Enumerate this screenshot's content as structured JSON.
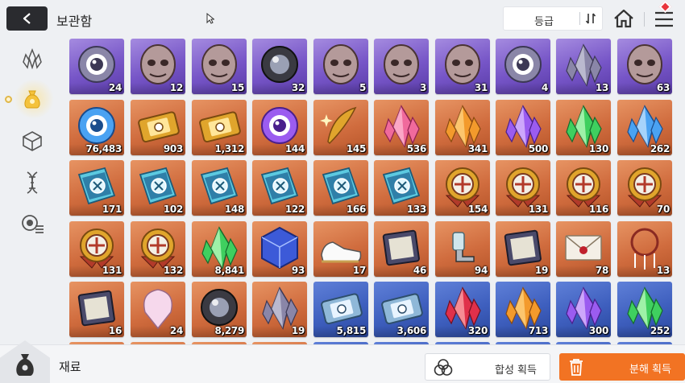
{
  "header": {
    "title": "보관함",
    "sort_label": "등급"
  },
  "sidebar": {
    "tabs": [
      {
        "icon": "crystal-cluster-icon",
        "active": false
      },
      {
        "icon": "material-bag-icon",
        "active": true
      },
      {
        "icon": "cube-icon",
        "active": false
      },
      {
        "icon": "dna-icon",
        "active": false
      },
      {
        "icon": "orb-list-icon",
        "active": false
      }
    ]
  },
  "inventory": {
    "rows": [
      [
        {
          "bg": "purple",
          "icon": "eye-card-icon",
          "qty": "24"
        },
        {
          "bg": "purple",
          "icon": "brain-head-icon",
          "qty": "12"
        },
        {
          "bg": "purple",
          "icon": "flesh-lump-icon",
          "qty": "15"
        },
        {
          "bg": "purple",
          "icon": "silver-orb-icon",
          "qty": "32"
        },
        {
          "bg": "purple",
          "icon": "monster-skull-icon",
          "qty": "5"
        },
        {
          "bg": "purple",
          "icon": "fleshy-head-icon",
          "qty": "3"
        },
        {
          "bg": "purple",
          "icon": "bloody-mass-icon",
          "qty": "31"
        },
        {
          "bg": "purple",
          "icon": "eyeball-icon",
          "qty": "4"
        },
        {
          "bg": "purple",
          "icon": "crystal-head-icon",
          "qty": "13"
        },
        {
          "bg": "purple",
          "icon": "shell-mask-icon",
          "qty": "63"
        }
      ],
      [
        {
          "bg": "orange",
          "icon": "blue-eye-core-icon",
          "qty": "76,483"
        },
        {
          "bg": "orange",
          "icon": "gold-ticket-icon",
          "qty": "903"
        },
        {
          "bg": "orange",
          "icon": "gold-prism-ticket-icon",
          "qty": "1,312"
        },
        {
          "bg": "orange",
          "icon": "purple-eye-core-icon",
          "qty": "144"
        },
        {
          "bg": "orange",
          "icon": "golden-feather-icon",
          "qty": "145"
        },
        {
          "bg": "orange",
          "icon": "pink-crystal-icon",
          "qty": "536"
        },
        {
          "bg": "orange",
          "icon": "orange-crystal-icon",
          "qty": "341"
        },
        {
          "bg": "orange",
          "icon": "purple-crystal-icon",
          "qty": "500"
        },
        {
          "bg": "orange",
          "icon": "green-crystal-icon",
          "qty": "130"
        },
        {
          "bg": "orange",
          "icon": "blue-crystal-icon",
          "qty": "262"
        }
      ],
      [
        {
          "bg": "orange",
          "icon": "spellbook-swords-icon",
          "qty": "171"
        },
        {
          "bg": "orange",
          "icon": "spellbook-shield-icon",
          "qty": "102"
        },
        {
          "bg": "orange",
          "icon": "spellbook-eye-icon",
          "qty": "148"
        },
        {
          "bg": "orange",
          "icon": "spellbook-cross-icon",
          "qty": "122"
        },
        {
          "bg": "orange",
          "icon": "spellbook-rune-icon",
          "qty": "166"
        },
        {
          "bg": "orange",
          "icon": "spellbook-orb-icon",
          "qty": "133"
        },
        {
          "bg": "orange",
          "icon": "medal-sword-icon",
          "qty": "154"
        },
        {
          "bg": "orange",
          "icon": "medal-shield-icon",
          "qty": "131"
        },
        {
          "bg": "orange",
          "icon": "medal-target-icon",
          "qty": "116"
        },
        {
          "bg": "orange",
          "icon": "medal-star-icon",
          "qty": "70"
        }
      ],
      [
        {
          "bg": "orange",
          "icon": "medal-compass-icon",
          "qty": "131"
        },
        {
          "bg": "orange",
          "icon": "medal-globe-icon",
          "qty": "132"
        },
        {
          "bg": "orange",
          "icon": "green-sparkle-shards-icon",
          "qty": "8,841"
        },
        {
          "bg": "orange",
          "icon": "blue-diamond-cube-icon",
          "qty": "93"
        },
        {
          "bg": "orange",
          "icon": "sneakers-icon",
          "qty": "17"
        },
        {
          "bg": "orange",
          "icon": "star-map-book-icon",
          "qty": "46"
        },
        {
          "bg": "orange",
          "icon": "spray-gun-icon",
          "qty": "94"
        },
        {
          "bg": "orange",
          "icon": "document-stack-icon",
          "qty": "19"
        },
        {
          "bg": "orange",
          "icon": "sealed-letter-icon",
          "qty": "78"
        },
        {
          "bg": "orange",
          "icon": "dreamcatcher-icon",
          "qty": "13"
        }
      ],
      [
        {
          "bg": "orange",
          "icon": "leather-journal-icon",
          "qty": "16"
        },
        {
          "bg": "orange",
          "icon": "opal-pick-icon",
          "qty": "24"
        },
        {
          "bg": "orange",
          "icon": "dark-thorn-orb-icon",
          "qty": "8,279"
        },
        {
          "bg": "orange",
          "icon": "crystal-cluster-item-icon",
          "qty": "19"
        },
        {
          "bg": "blue",
          "icon": "silver-ticket-icon",
          "qty": "5,815"
        },
        {
          "bg": "blue",
          "icon": "silver-prism-ticket-icon",
          "qty": "3,606"
        },
        {
          "bg": "blue",
          "icon": "red-shard-icon",
          "qty": "320"
        },
        {
          "bg": "blue",
          "icon": "amber-shard-icon",
          "qty": "713"
        },
        {
          "bg": "blue",
          "icon": "violet-shard-icon",
          "qty": "300"
        },
        {
          "bg": "blue",
          "icon": "emerald-shard-icon",
          "qty": "252"
        }
      ]
    ]
  },
  "footer": {
    "category_label": "재료",
    "synthesis_button": "합성 획득",
    "decompose_button": "분해 획득"
  },
  "colors": {
    "accent": "#f27323",
    "purple_tier": "#7655c7",
    "orange_tier": "#d06c3e",
    "blue_tier": "#3e5fbe"
  }
}
